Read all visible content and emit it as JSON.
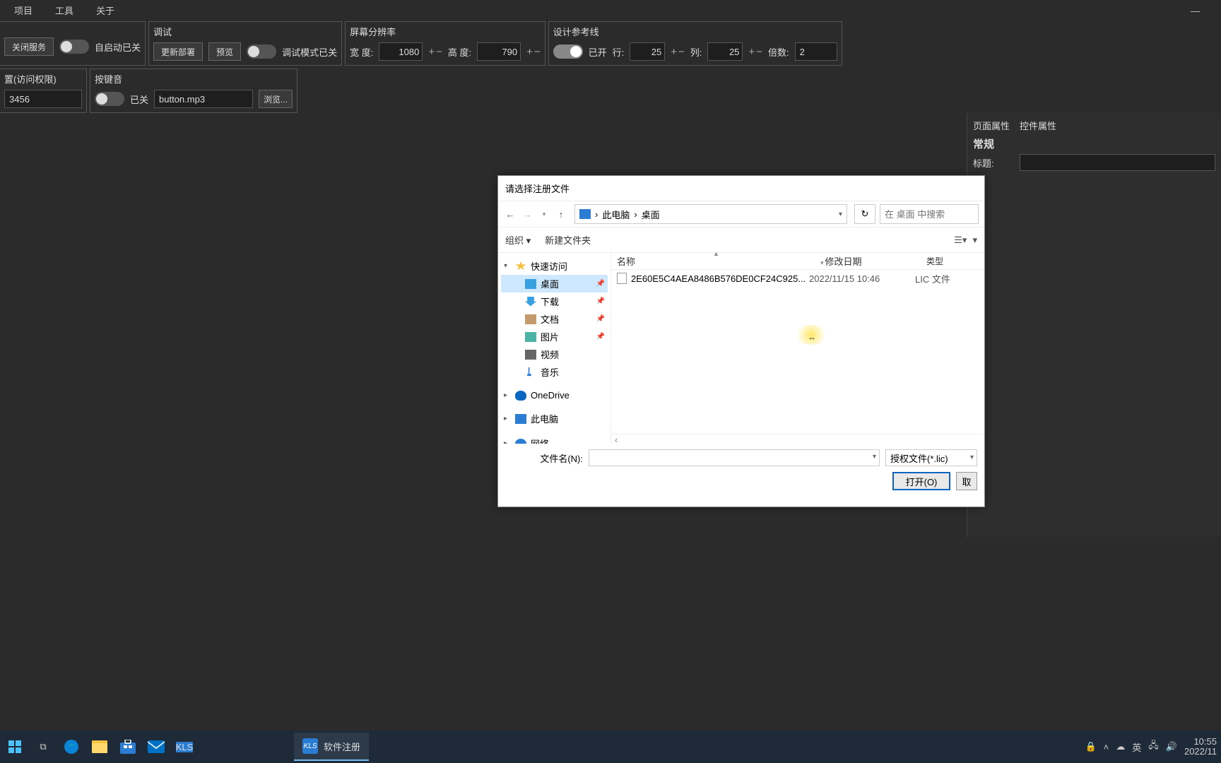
{
  "menu": {
    "project": "项目",
    "tools": "工具",
    "about": "关于"
  },
  "groups": {
    "service": {
      "close_btn": "关闭服务",
      "autostart_label": "自启动已关"
    },
    "debug": {
      "title": "调试",
      "deploy_btn": "更新部署",
      "preview_btn": "预览",
      "mode_label": "调试模式已关"
    },
    "resolution": {
      "title": "屏幕分辨率",
      "width_label": "宽  度:",
      "width_val": "1080",
      "height_label": "高  度:",
      "height_val": "790"
    },
    "guides": {
      "title": "设计参考线",
      "state_label": "已开",
      "row_label": "行:",
      "row_val": "25",
      "col_label": "列:",
      "col_val": "25",
      "mult_label": "倍数:",
      "mult_val": "2"
    },
    "access": {
      "title": "置(访问权限)",
      "val": "3456"
    },
    "keysound": {
      "title": "按键音",
      "state_label": "已关",
      "file_val": "button.mp3",
      "browse_btn": "浏览..."
    }
  },
  "props": {
    "tab_page": "页面属性",
    "tab_ctrl": "控件属性",
    "section": "常规",
    "title_label": "标题:"
  },
  "dialog": {
    "title": "请选择注册文件",
    "path_pc": "此电脑",
    "path_loc": "桌面",
    "search_placeholder": "在 桌面 中搜索",
    "organize": "组织",
    "new_folder": "新建文件夹",
    "col_name": "名称",
    "col_date": "修改日期",
    "col_type": "类型",
    "tree": {
      "quick": "快速访问",
      "desktop": "桌面",
      "downloads": "下载",
      "documents": "文档",
      "pictures": "图片",
      "videos": "视频",
      "music": "音乐",
      "onedrive": "OneDrive",
      "thispc": "此电脑",
      "network": "网络"
    },
    "file": {
      "name": "2E60E5C4AEA8486B576DE0CF24C925...",
      "date": "2022/11/15 10:46",
      "type": "LIC 文件"
    },
    "filename_label": "文件名(N):",
    "filter": "授权文件(*.lic)",
    "open_btn": "打开(O)",
    "cancel_btn": "取"
  },
  "taskbar": {
    "app_label": "软件注册",
    "ime": "英",
    "time": "10:55",
    "date": "2022/11"
  }
}
